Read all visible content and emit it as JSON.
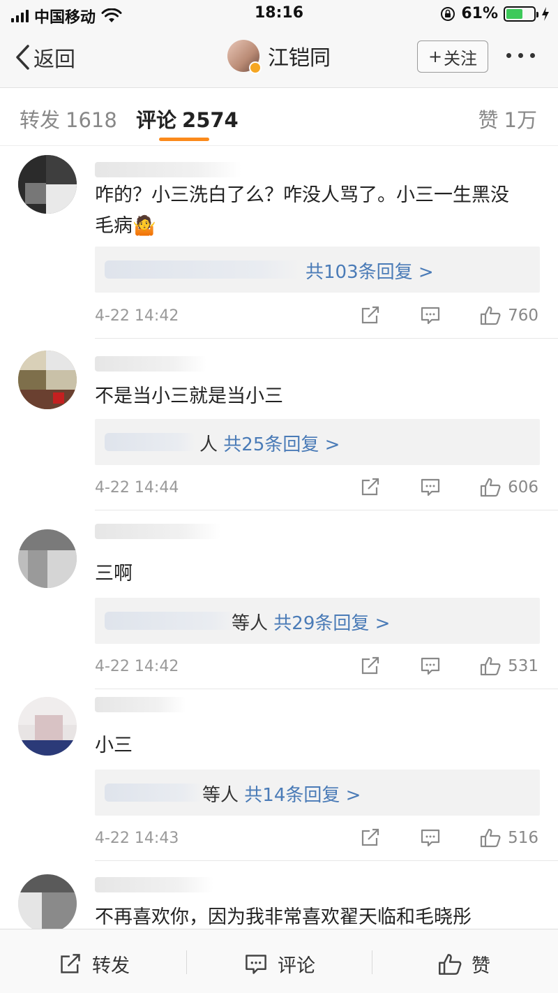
{
  "status_bar": {
    "carrier": "中国移动",
    "time": "18:16",
    "battery_percent_text": "61%",
    "battery_level": 0.61,
    "battery_color": "#3dc95a",
    "icons": [
      "signal-icon",
      "wifi-icon",
      "rotation-lock-icon",
      "battery-icon",
      "charging-bolt-icon"
    ]
  },
  "nav": {
    "back_label": "返回",
    "title": "江铠同",
    "follow_label": "关注",
    "follow_plus": "+"
  },
  "tabs": [
    {
      "label": "转发",
      "count": "1618"
    },
    {
      "label": "评论",
      "count": "2574"
    },
    {
      "label": "赞",
      "count": "1万"
    }
  ],
  "accent_color": "#fb8a1c",
  "link_color": "#4a7bb7",
  "comments": [
    {
      "text_lines": [
        "咋的？小三洗白了么？咋没人骂了。小三一生黑没",
        "毛病🤷"
      ],
      "reply_prefix": "",
      "reply_link": "共103条回复 >",
      "time": "4-22 14:42",
      "likes": "760"
    },
    {
      "text_lines": [
        "不是当小三就是当小三"
      ],
      "reply_prefix": "人",
      "reply_link": "共25条回复 >",
      "time": "4-22 14:44",
      "likes": "606"
    },
    {
      "text_lines": [
        "三啊"
      ],
      "reply_prefix": "等人",
      "reply_link": "共29条回复 >",
      "time": "4-22 14:42",
      "likes": "531"
    },
    {
      "text_lines": [
        "小三"
      ],
      "reply_prefix": "等人",
      "reply_link": "共14条回复 >",
      "time": "4-22 14:43",
      "likes": "516"
    },
    {
      "text_lines": [
        "不再喜欢你，因为我非常喜欢翟天临和毛晓彤"
      ]
    }
  ],
  "bottom_bar": {
    "repost_label": "转发",
    "comment_label": "评论",
    "like_label": "赞"
  }
}
